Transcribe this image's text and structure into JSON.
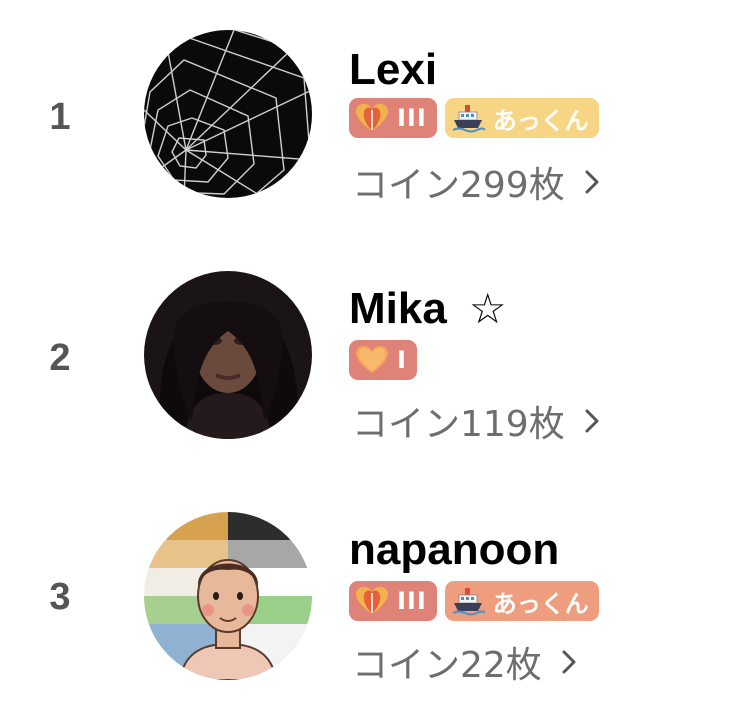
{
  "ranking": [
    {
      "rank": "1",
      "name": "Lexi",
      "star": "",
      "level_label": "III",
      "tag_label": "あっくん",
      "tag_color": "#f6d685",
      "coins_label": "コイン299枚",
      "avatar_icon": "spider-web"
    },
    {
      "rank": "2",
      "name": "Mika",
      "star": "☆",
      "level_label": "I",
      "tag_label": "",
      "tag_color": "",
      "coins_label": "コイン119枚",
      "avatar_icon": "portrait-photo"
    },
    {
      "rank": "3",
      "name": "napanoon",
      "star": "",
      "level_label": "III",
      "tag_label": "あっくん",
      "tag_color": "#ee9e7e",
      "coins_label": "コイン22枚",
      "avatar_icon": "cartoon-portrait"
    }
  ],
  "colors": {
    "level_badge": "#df8277",
    "coins_text": "#6e6e6e",
    "rank_text": "#555555"
  }
}
